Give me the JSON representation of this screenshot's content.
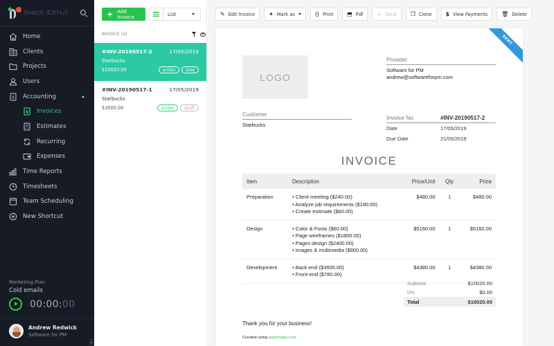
{
  "sidebar": {
    "search_placeholder": "Search (Ctrl+/)",
    "nav": [
      {
        "label": "Home",
        "icon": "home-icon"
      },
      {
        "label": "Clients",
        "icon": "building-icon"
      },
      {
        "label": "Projects",
        "icon": "folder-icon"
      },
      {
        "label": "Users",
        "icon": "user-icon"
      },
      {
        "label": "Accounting",
        "icon": "ledger-icon",
        "expanded": true
      },
      {
        "label": "Invoices",
        "icon": "invoice-icon",
        "sub": true,
        "active": true
      },
      {
        "label": "Estimates",
        "icon": "calculator-icon",
        "sub": true
      },
      {
        "label": "Recurring",
        "icon": "recurring-icon",
        "sub": true
      },
      {
        "label": "Expenses",
        "icon": "wallet-icon",
        "sub": true
      },
      {
        "label": "Time Reports",
        "icon": "bar-chart-icon"
      },
      {
        "label": "Timesheets",
        "icon": "clock-icon"
      },
      {
        "label": "Team Scheduling",
        "icon": "calendar-icon"
      },
      {
        "label": "New Shortcut",
        "icon": "plus-circle-icon"
      }
    ],
    "timer": {
      "project": "Marketing Plan",
      "task": "Cold emails",
      "time_main": "00:00:",
      "time_seconds": "00"
    },
    "user": {
      "name": "Andrew Redwick",
      "org": "Software for PM"
    },
    "collapse_glyph": "‹"
  },
  "list": {
    "add_label": "Add Invoice",
    "view_label": "List",
    "header": "INVOICE (2)",
    "items": [
      {
        "number": "#INV-20190517-2",
        "date": "17/05/2019",
        "client": "Starbucks",
        "amount": "$10020.00",
        "badges": [
          "active",
          "sent"
        ],
        "selected": true
      },
      {
        "number": "#INV-20190517-1",
        "date": "17/05/2019",
        "client": "Starbucks",
        "amount": "$3000.00",
        "badges": [
          "active",
          "draft"
        ],
        "selected": false
      }
    ],
    "collapse_glyph": "‹"
  },
  "toolbar": {
    "edit": "Edit Invoice",
    "mark": "Mark as",
    "print": "Print",
    "pdf": "Pdf",
    "send": "Send",
    "clone": "Clone",
    "payments": "View Payments",
    "delete": "Delete"
  },
  "invoice": {
    "ribbon": "SENT",
    "logo_text": "LOGO",
    "provider_label": "Provider",
    "provider_name": "Software for PM",
    "provider_email": "andrew@softwareforpm.com",
    "customer_label": "Customer",
    "customer_name": "Starbucks",
    "number_label": "Invoice No.",
    "number": "#INV-20190517-2",
    "date_label": "Date",
    "date": "17/05/2019",
    "due_label": "Due Date",
    "due": "21/05/2019",
    "title": "INVOICE",
    "columns": [
      "Item",
      "Description",
      "Price/Unit",
      "Qty",
      "Price"
    ],
    "rows": [
      {
        "item": "Preparation",
        "desc": [
          "• Client meeting ($240.00)",
          "• Analyze job requirements ($180.00)",
          "• Create estimate ($60.00)"
        ],
        "unit": "$480.00",
        "qty": "1",
        "price": "$480.00"
      },
      {
        "item": "Design",
        "desc": [
          "• Color & Fonts ($60.00)",
          "• Page wireframes ($1800.00)",
          "• Pages design ($2400.00)",
          "• Images & multimedia ($900.00)"
        ],
        "unit": "$5160.00",
        "qty": "1",
        "price": "$5160.00"
      },
      {
        "item": "Development",
        "desc": [
          "• Back-end ($3600.00)",
          "• Front-end ($780.00)"
        ],
        "unit": "$4380.00",
        "qty": "1",
        "price": "$4380.00"
      }
    ],
    "subtotal_label": "Subtotal",
    "subtotal": "$10020.00",
    "tax_label": "0%",
    "tax": "$0.00",
    "total_label": "Total",
    "total": "$10020.00",
    "thanks": "Thank you for your business!",
    "created_prefix": "Created using ",
    "created_link": "paymoapp.com"
  },
  "colors": {
    "accent_green": "#28c34f",
    "selected_teal": "#2bcaa3",
    "ribbon_blue": "#3498db",
    "sidebar_bg": "#161b26"
  }
}
